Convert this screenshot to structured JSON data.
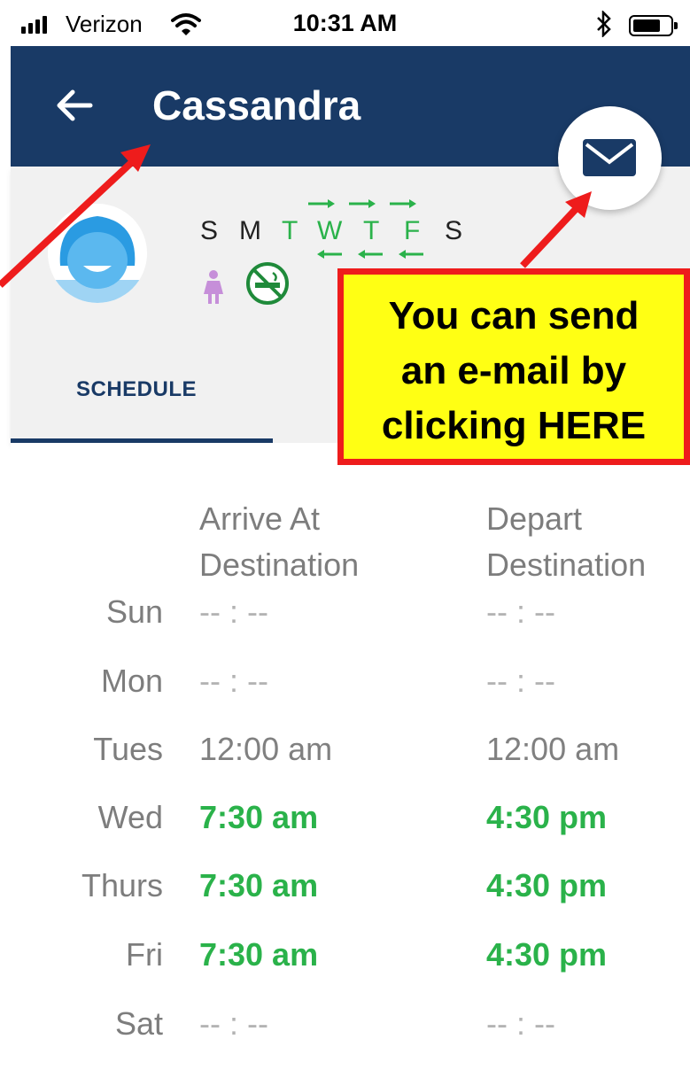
{
  "status_bar": {
    "carrier": "Verizon",
    "time": "10:31 AM",
    "icons": [
      "signal-icon",
      "wifi-icon",
      "bluetooth-icon",
      "battery-icon"
    ]
  },
  "app_bar": {
    "title": "Cassandra",
    "back_icon": "arrow-left-icon",
    "color": "#193a66"
  },
  "profile": {
    "avatar_icon": "female-avatar-icon",
    "days": [
      {
        "label": "S",
        "active": false
      },
      {
        "label": "M",
        "active": false
      },
      {
        "label": "T",
        "active": true
      },
      {
        "label": "W",
        "active": true
      },
      {
        "label": "T",
        "active": true
      },
      {
        "label": "F",
        "active": true
      },
      {
        "label": "S",
        "active": false
      }
    ],
    "badges": [
      "female-icon",
      "no-smoking-icon"
    ],
    "accent_green": "#2ab24a",
    "badge_purple": "#c68fd9"
  },
  "tabs": [
    {
      "label": "SCHEDULE",
      "selected": true
    }
  ],
  "fab": {
    "icon": "mail-icon"
  },
  "schedule": {
    "arrive_header": [
      "Arrive At",
      "Destination"
    ],
    "depart_header": [
      "Depart",
      "Destination"
    ],
    "rows": [
      {
        "day": "Sun",
        "arrive": "-- : --",
        "depart": "-- : --",
        "state": "empty"
      },
      {
        "day": "Mon",
        "arrive": "-- : --",
        "depart": "-- : --",
        "state": "empty"
      },
      {
        "day": "Tues",
        "arrive": "12:00 am",
        "depart": "12:00 am",
        "state": "set"
      },
      {
        "day": "Wed",
        "arrive": "7:30 am",
        "depart": "4:30 pm",
        "state": "active"
      },
      {
        "day": "Thurs",
        "arrive": "7:30 am",
        "depart": "4:30 pm",
        "state": "active"
      },
      {
        "day": "Fri",
        "arrive": "7:30 am",
        "depart": "4:30 pm",
        "state": "active"
      },
      {
        "day": "Sat",
        "arrive": "-- : --",
        "depart": "-- : --",
        "state": "empty"
      }
    ]
  },
  "annotation": {
    "lines": [
      "You can send",
      "an e-mail by",
      "clicking HERE"
    ],
    "box_color": "#ffff14",
    "arrow_color": "#ee1c1c"
  }
}
